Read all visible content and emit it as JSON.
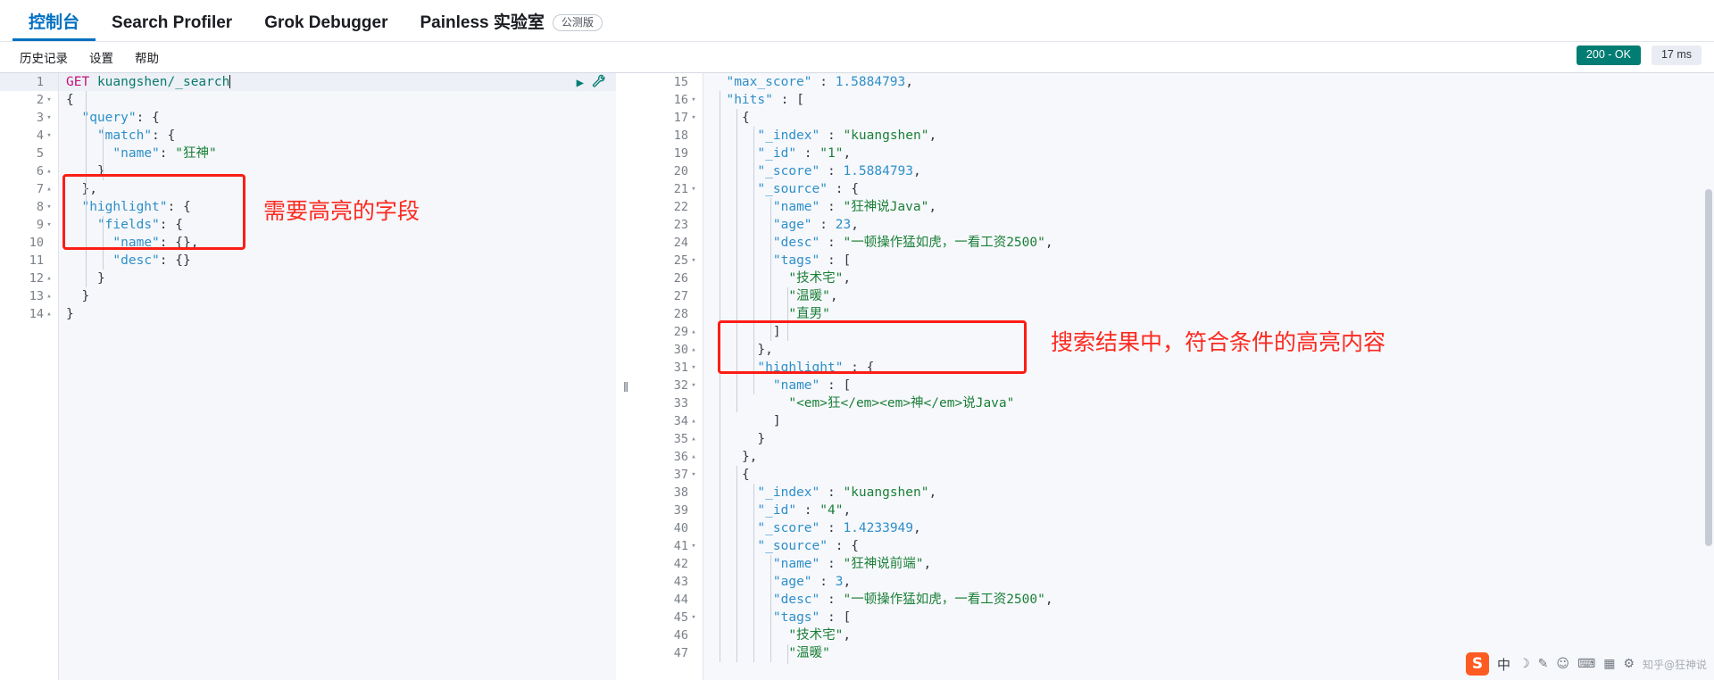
{
  "topnav": {
    "tabs": [
      {
        "label": "控制台",
        "active": true
      },
      {
        "label": "Search Profiler",
        "active": false
      },
      {
        "label": "Grok Debugger",
        "active": false
      },
      {
        "label": "Painless 实验室",
        "active": false,
        "badge": "公测版"
      }
    ]
  },
  "subnav": {
    "items": [
      "历史记录",
      "设置",
      "帮助"
    ],
    "status_code": "200 - OK",
    "status_time": "17 ms"
  },
  "request_editor": {
    "run_icon": "play-icon",
    "wrench_icon": "wrench-icon",
    "lines": [
      {
        "n": 1,
        "fold": "",
        "text": "GET kuangshen/_search",
        "kind": "request"
      },
      {
        "n": 2,
        "fold": "▾",
        "text": "{"
      },
      {
        "n": 3,
        "fold": "▾",
        "text": "  \"query\": {"
      },
      {
        "n": 4,
        "fold": "▾",
        "text": "    \"match\": {"
      },
      {
        "n": 5,
        "fold": "",
        "text": "      \"name\": \"狂神\""
      },
      {
        "n": 6,
        "fold": "▴",
        "text": "    }"
      },
      {
        "n": 7,
        "fold": "▴",
        "text": "  },"
      },
      {
        "n": 8,
        "fold": "▾",
        "text": "  \"highlight\": {"
      },
      {
        "n": 9,
        "fold": "▾",
        "text": "    \"fields\": {"
      },
      {
        "n": 10,
        "fold": "",
        "text": "      \"name\": {},"
      },
      {
        "n": 11,
        "fold": "",
        "text": "      \"desc\": {}"
      },
      {
        "n": 12,
        "fold": "▴",
        "text": "    }"
      },
      {
        "n": 13,
        "fold": "▴",
        "text": "  }"
      },
      {
        "n": 14,
        "fold": "▴",
        "text": "}"
      }
    ],
    "annotation": "需要高亮的字段"
  },
  "response_viewer": {
    "lines": [
      {
        "n": 15,
        "fold": "",
        "text": "  \"max_score\" : 1.5884793,"
      },
      {
        "n": 16,
        "fold": "▾",
        "text": "  \"hits\" : ["
      },
      {
        "n": 17,
        "fold": "▾",
        "text": "    {"
      },
      {
        "n": 18,
        "fold": "",
        "text": "      \"_index\" : \"kuangshen\","
      },
      {
        "n": 19,
        "fold": "",
        "text": "      \"_id\" : \"1\","
      },
      {
        "n": 20,
        "fold": "",
        "text": "      \"_score\" : 1.5884793,"
      },
      {
        "n": 21,
        "fold": "▾",
        "text": "      \"_source\" : {"
      },
      {
        "n": 22,
        "fold": "",
        "text": "        \"name\" : \"狂神说Java\","
      },
      {
        "n": 23,
        "fold": "",
        "text": "        \"age\" : 23,"
      },
      {
        "n": 24,
        "fold": "",
        "text": "        \"desc\" : \"一顿操作猛如虎，一看工资2500\","
      },
      {
        "n": 25,
        "fold": "▾",
        "text": "        \"tags\" : ["
      },
      {
        "n": 26,
        "fold": "",
        "text": "          \"技术宅\","
      },
      {
        "n": 27,
        "fold": "",
        "text": "          \"温暖\","
      },
      {
        "n": 28,
        "fold": "",
        "text": "          \"直男\""
      },
      {
        "n": 29,
        "fold": "▴",
        "text": "        ]"
      },
      {
        "n": 30,
        "fold": "▴",
        "text": "      },"
      },
      {
        "n": 31,
        "fold": "▾",
        "text": "      \"highlight\" : {"
      },
      {
        "n": 32,
        "fold": "▾",
        "text": "        \"name\" : ["
      },
      {
        "n": 33,
        "fold": "",
        "text": "          \"<em>狂</em><em>神</em>说Java\""
      },
      {
        "n": 34,
        "fold": "▴",
        "text": "        ]"
      },
      {
        "n": 35,
        "fold": "▴",
        "text": "      }"
      },
      {
        "n": 36,
        "fold": "▴",
        "text": "    },"
      },
      {
        "n": 37,
        "fold": "▾",
        "text": "    {"
      },
      {
        "n": 38,
        "fold": "",
        "text": "      \"_index\" : \"kuangshen\","
      },
      {
        "n": 39,
        "fold": "",
        "text": "      \"_id\" : \"4\","
      },
      {
        "n": 40,
        "fold": "",
        "text": "      \"_score\" : 1.4233949,"
      },
      {
        "n": 41,
        "fold": "▾",
        "text": "      \"_source\" : {"
      },
      {
        "n": 42,
        "fold": "",
        "text": "        \"name\" : \"狂神说前端\","
      },
      {
        "n": 43,
        "fold": "",
        "text": "        \"age\" : 3,"
      },
      {
        "n": 44,
        "fold": "",
        "text": "        \"desc\" : \"一顿操作猛如虎，一看工资2500\","
      },
      {
        "n": 45,
        "fold": "▾",
        "text": "        \"tags\" : ["
      },
      {
        "n": 46,
        "fold": "",
        "text": "          \"技术宅\","
      },
      {
        "n": 47,
        "fold": "",
        "text": "          \"温暖\""
      }
    ],
    "annotation": "搜索结果中，符合条件的高亮内容"
  },
  "ime_bar": {
    "logo": "S",
    "items": [
      "中",
      "☽",
      "✎",
      "☺",
      "⌨",
      "▦",
      "⚙"
    ],
    "watermark": "知乎@狂神说"
  },
  "colors": {
    "accent": "#0070c1",
    "annotation_red": "#fc1d16",
    "status_green": "#017d73",
    "string_green": "#1a7f37",
    "key_blue": "#2d8fc9",
    "method_pink": "#c4147b"
  }
}
